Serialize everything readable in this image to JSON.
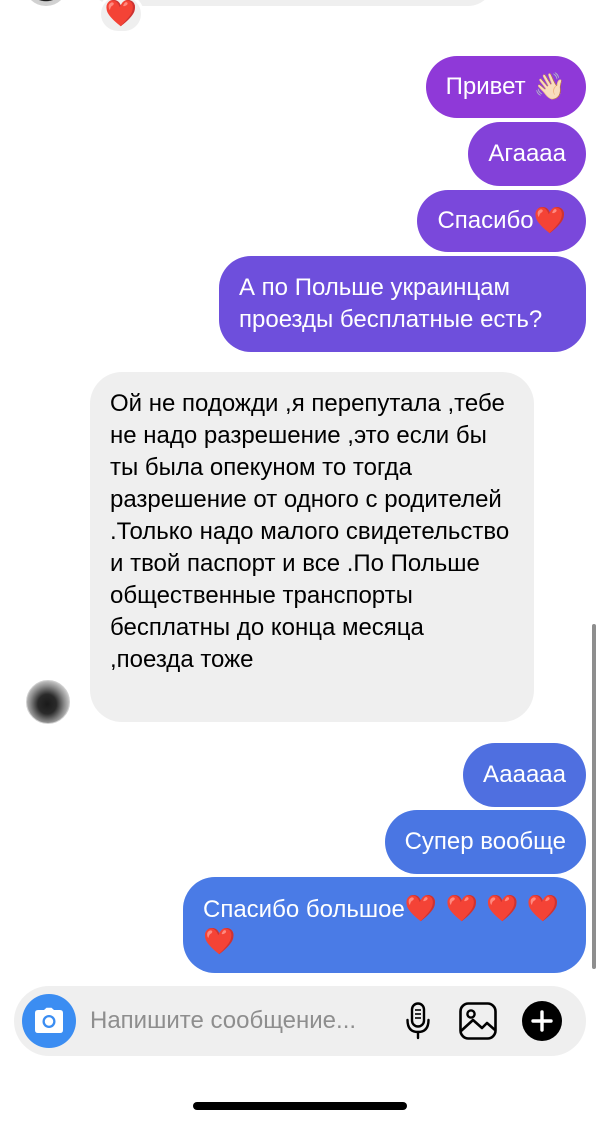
{
  "thread": {
    "top_reaction_emoji": "❤️",
    "sent_messages_purple": [
      {
        "text": "Привет",
        "emoji": "👋🏻"
      },
      {
        "text": "Агаааа"
      },
      {
        "text": "Спасибо",
        "emoji": "❤️"
      },
      {
        "text": "А по Польше украинцам проезды бесплатные есть?"
      }
    ],
    "received_message": {
      "text": "Ой не подожди ,я перепутала ,тебе не надо разрешение ,это если бы ты была опекуном то тогда разрешение от одного с родителей .Только надо малого свидетельство и твой паспорт и все .По Польше общественные транспорты бесплатны до конца месяца ,поезда тоже"
    },
    "sent_messages_blue": [
      {
        "text": "Аааааа"
      },
      {
        "text": "Супер вообще"
      },
      {
        "text": "Спасибо большое",
        "emoji": "❤️ ❤️ ❤️ ❤️ ❤️"
      }
    ]
  },
  "composer": {
    "placeholder": "Напишите сообщение...",
    "value": ""
  },
  "icons": {
    "camera": "camera-icon",
    "microphone": "microphone-icon",
    "gallery": "gallery-icon",
    "add": "plus-icon"
  },
  "colors": {
    "sent_purple_top": "#8f39d8",
    "sent_purple_bottom": "#6e4fdc",
    "sent_blue": "#4a7be6",
    "received_bg": "#efefef",
    "camera_button": "#3b8df2"
  }
}
